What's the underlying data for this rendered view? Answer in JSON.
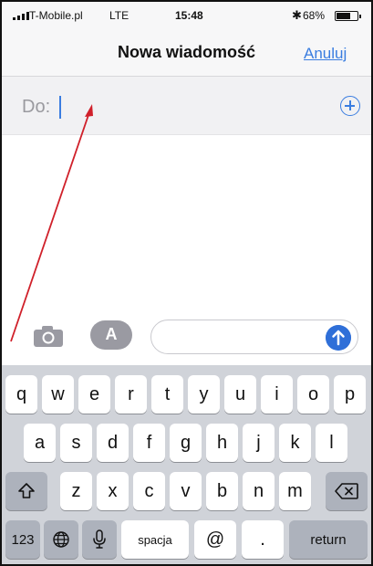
{
  "status_bar": {
    "carrier": "T-Mobile.pl",
    "network": "LTE",
    "time": "15:48",
    "battery_percent": "68%",
    "battery_level": 0.68,
    "bluetooth_icon": "bluetooth-icon"
  },
  "nav": {
    "title": "Nowa wiadomość",
    "cancel": "Anuluj"
  },
  "compose": {
    "to_label": "Do:",
    "add_contact_icon": "plus-circle-icon"
  },
  "input_bar": {
    "camera_icon": "camera-icon",
    "apps_icon": "app-store-icon",
    "send_icon": "arrow-up-icon"
  },
  "keyboard": {
    "row1": [
      "q",
      "w",
      "e",
      "r",
      "t",
      "y",
      "u",
      "i",
      "o",
      "p"
    ],
    "row2": [
      "a",
      "s",
      "d",
      "f",
      "g",
      "h",
      "j",
      "k",
      "l"
    ],
    "row3": [
      "z",
      "x",
      "c",
      "v",
      "b",
      "n",
      "m"
    ],
    "numbers": "123",
    "space": "spacja",
    "at": "@",
    "dot": ".",
    "return": "return"
  },
  "colors": {
    "accent": "#3a7de0",
    "send": "#2f6fd8",
    "annotation_arrow": "#d0202a"
  }
}
